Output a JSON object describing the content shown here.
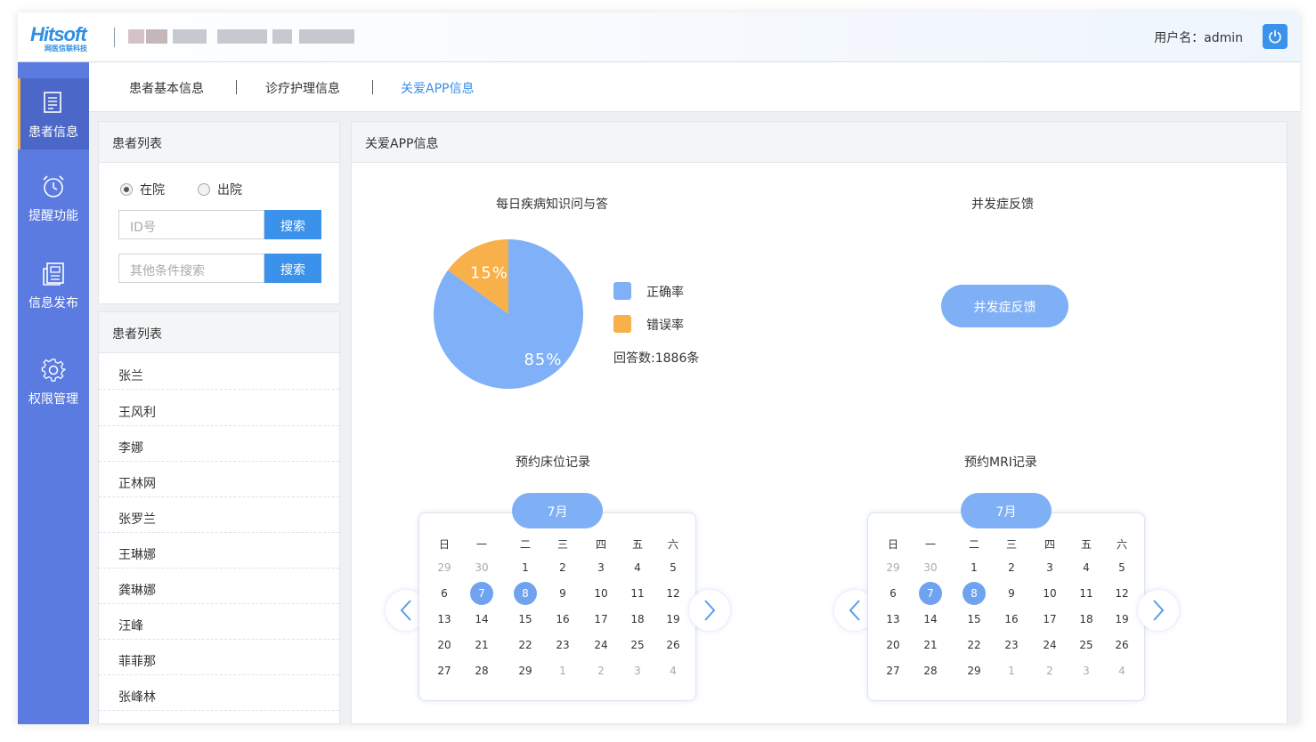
{
  "header": {
    "logo_text": "Hitsoft",
    "logo_sub": "网医信联科技",
    "user_label": "用户名：admin"
  },
  "sidebar": {
    "items": [
      {
        "label": "患者信息",
        "icon": "document-icon",
        "active": true
      },
      {
        "label": "提醒功能",
        "icon": "alarm-clock-icon",
        "active": false
      },
      {
        "label": "信息发布",
        "icon": "newspaper-icon",
        "active": false
      },
      {
        "label": "权限管理",
        "icon": "gear-icon",
        "active": false
      }
    ]
  },
  "tabs": [
    {
      "label": "患者基本信息",
      "active": false
    },
    {
      "label": "诊疗护理信息",
      "active": false
    },
    {
      "label": "关爱APP信息",
      "active": true
    }
  ],
  "search_panel": {
    "title": "患者列表",
    "radio_in": "在院",
    "radio_out": "出院",
    "radio_selected": "在院",
    "id_placeholder": "ID号",
    "other_placeholder": "其他条件搜索",
    "search_label": "搜索"
  },
  "patient_list": {
    "title": "患者列表",
    "items": [
      "张兰",
      "王风利",
      "李娜",
      "正林网",
      "张罗兰",
      "王琳娜",
      "龚琳娜",
      "汪峰",
      "菲菲那",
      "张峰林"
    ]
  },
  "main": {
    "title": "关爱APP信息",
    "qa_title": "每日疾病知识问与答",
    "complication_title": "并发症反馈",
    "complication_button": "并发症反馈",
    "answer_count": "回答数:1886条",
    "bed_title": "预约床位记录",
    "mri_title": "预约MRI记录"
  },
  "chart_data": {
    "type": "pie",
    "title": "每日疾病知识问与答",
    "slices": [
      {
        "label": "正确率",
        "value": 85,
        "text": "85%",
        "color": "#7fb0f8"
      },
      {
        "label": "错误率",
        "value": 15,
        "text": "15%",
        "color": "#f7b04a"
      }
    ]
  },
  "calendar": {
    "month": "7月",
    "weekdays": [
      "日",
      "一",
      "二",
      "三",
      "四",
      "五",
      "六"
    ],
    "weeks": [
      [
        {
          "d": "29",
          "m": true
        },
        {
          "d": "30",
          "m": true
        },
        {
          "d": "1"
        },
        {
          "d": "2"
        },
        {
          "d": "3"
        },
        {
          "d": "4"
        },
        {
          "d": "5"
        }
      ],
      [
        {
          "d": "6"
        },
        {
          "d": "7",
          "s": true
        },
        {
          "d": "8",
          "s": true
        },
        {
          "d": "9"
        },
        {
          "d": "10"
        },
        {
          "d": "11"
        },
        {
          "d": "12"
        }
      ],
      [
        {
          "d": "13"
        },
        {
          "d": "14"
        },
        {
          "d": "15"
        },
        {
          "d": "16"
        },
        {
          "d": "17"
        },
        {
          "d": "18"
        },
        {
          "d": "19"
        }
      ],
      [
        {
          "d": "20"
        },
        {
          "d": "21"
        },
        {
          "d": "22"
        },
        {
          "d": "23"
        },
        {
          "d": "24"
        },
        {
          "d": "25"
        },
        {
          "d": "26"
        }
      ],
      [
        {
          "d": "27"
        },
        {
          "d": "28"
        },
        {
          "d": "29"
        },
        {
          "d": "1",
          "m": true
        },
        {
          "d": "2",
          "m": true
        },
        {
          "d": "3",
          "m": true
        },
        {
          "d": "4",
          "m": true
        }
      ]
    ]
  },
  "colors": {
    "sidebar": "#5b7be0",
    "accent": "#3a92ea",
    "active_indicator": "#f3b441",
    "pill": "#7fb0f5"
  }
}
